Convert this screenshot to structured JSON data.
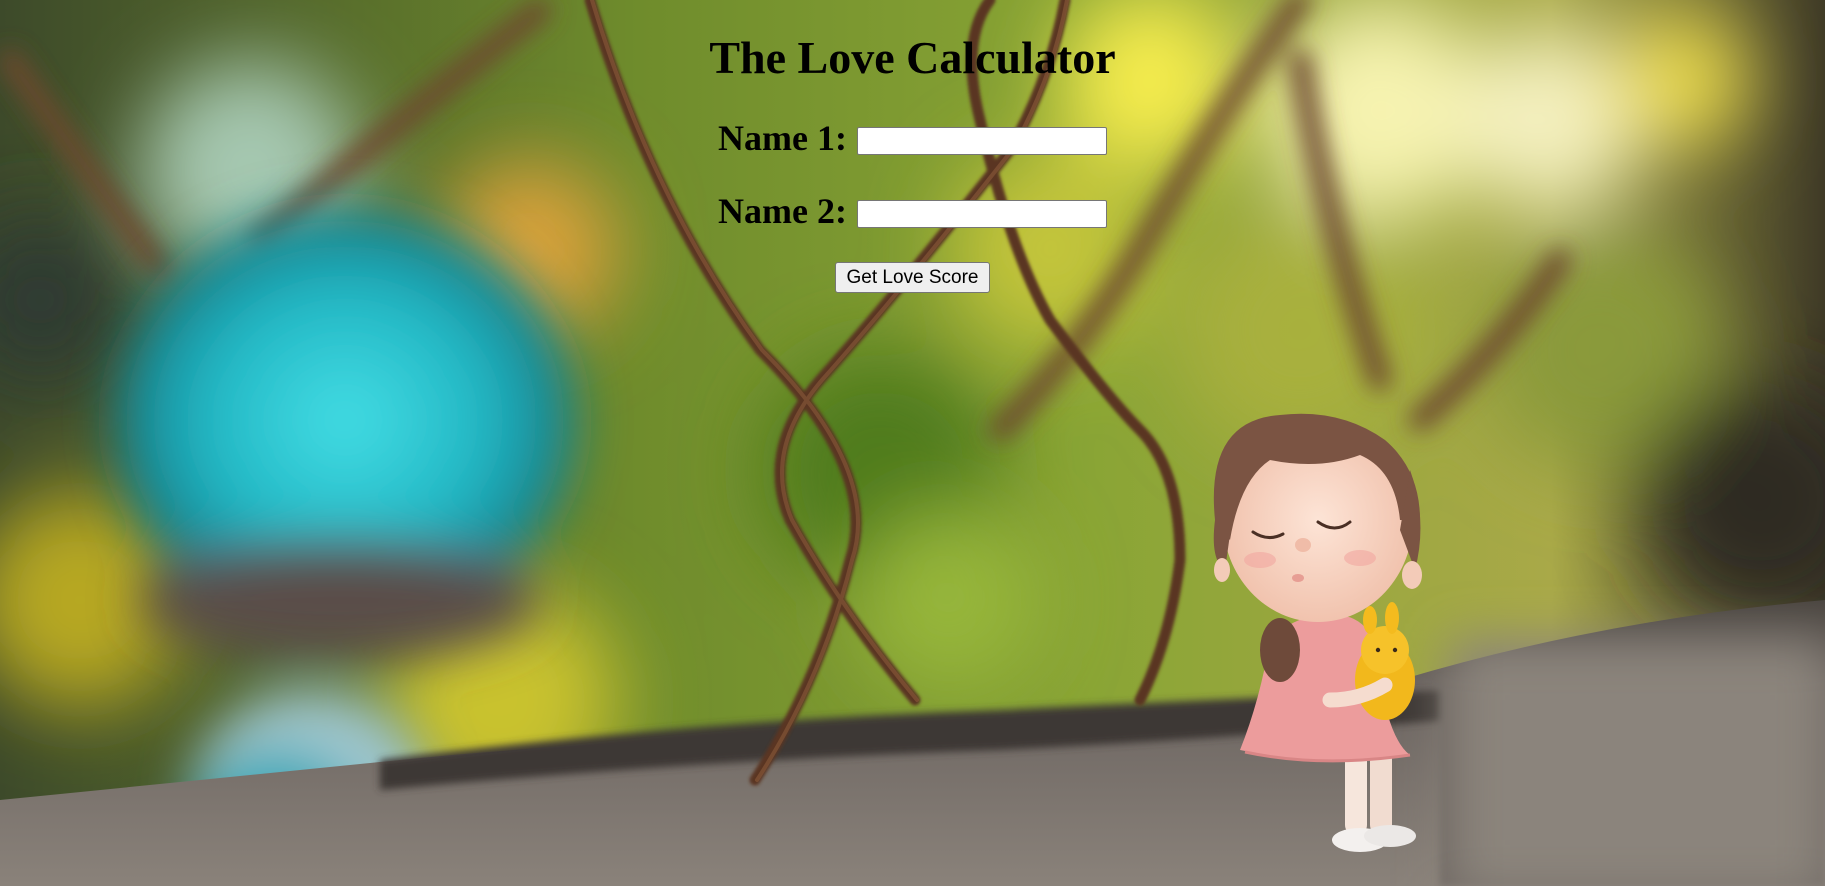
{
  "page": {
    "title": "The Love Calculator"
  },
  "form": {
    "name1_label": "Name 1:",
    "name1_value": "",
    "name2_label": "Name 2:",
    "name2_value": "",
    "submit_label": "Get Love Score"
  },
  "background": {
    "description_icon": "photo-figurine-girl-with-fence",
    "colors": {
      "bokeh_green": "#7d9a2a",
      "bokeh_yellow": "#f2e04a",
      "teal_blur": "#2ec4cf",
      "stone": "#6e6660",
      "rust": "#6b3b22"
    }
  }
}
